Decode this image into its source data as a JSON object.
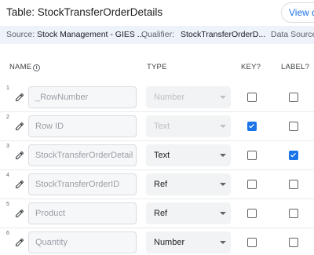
{
  "header": {
    "title": "Table: StockTransferOrderDetails",
    "view_button": "View da"
  },
  "infobar": {
    "source_label": "Source:",
    "source_value": "Stock Management - GIES ...",
    "qualifier_label": "Qualifier:",
    "qualifier_value": "StockTransferOrderD...",
    "data_source_label": "Data Source:"
  },
  "columns": {
    "name": "NAME",
    "type": "TYPE",
    "key": "KEY?",
    "label": "LABEL?"
  },
  "rows": [
    {
      "num": "1",
      "name": "_RowNumber",
      "type": "Number",
      "key": false,
      "label": false
    },
    {
      "num": "2",
      "name": "Row ID",
      "type": "Text",
      "key": true,
      "label": false
    },
    {
      "num": "3",
      "name": "StockTransferOrderDetail",
      "type": "Text",
      "key": false,
      "label": true
    },
    {
      "num": "4",
      "name": "StockTransferOrderID",
      "type": "Ref",
      "key": false,
      "label": false
    },
    {
      "num": "5",
      "name": "Product",
      "type": "Ref",
      "key": false,
      "label": false
    },
    {
      "num": "6",
      "name": "Quantity",
      "type": "Number",
      "key": false,
      "label": false
    }
  ],
  "colors": {
    "accent": "#1a73e8",
    "infobar_bg": "#eef2fb"
  },
  "icons": {
    "edit": "pencil-icon",
    "info": "info-icon",
    "dropdown": "caret-down-icon",
    "check": "check-icon"
  }
}
